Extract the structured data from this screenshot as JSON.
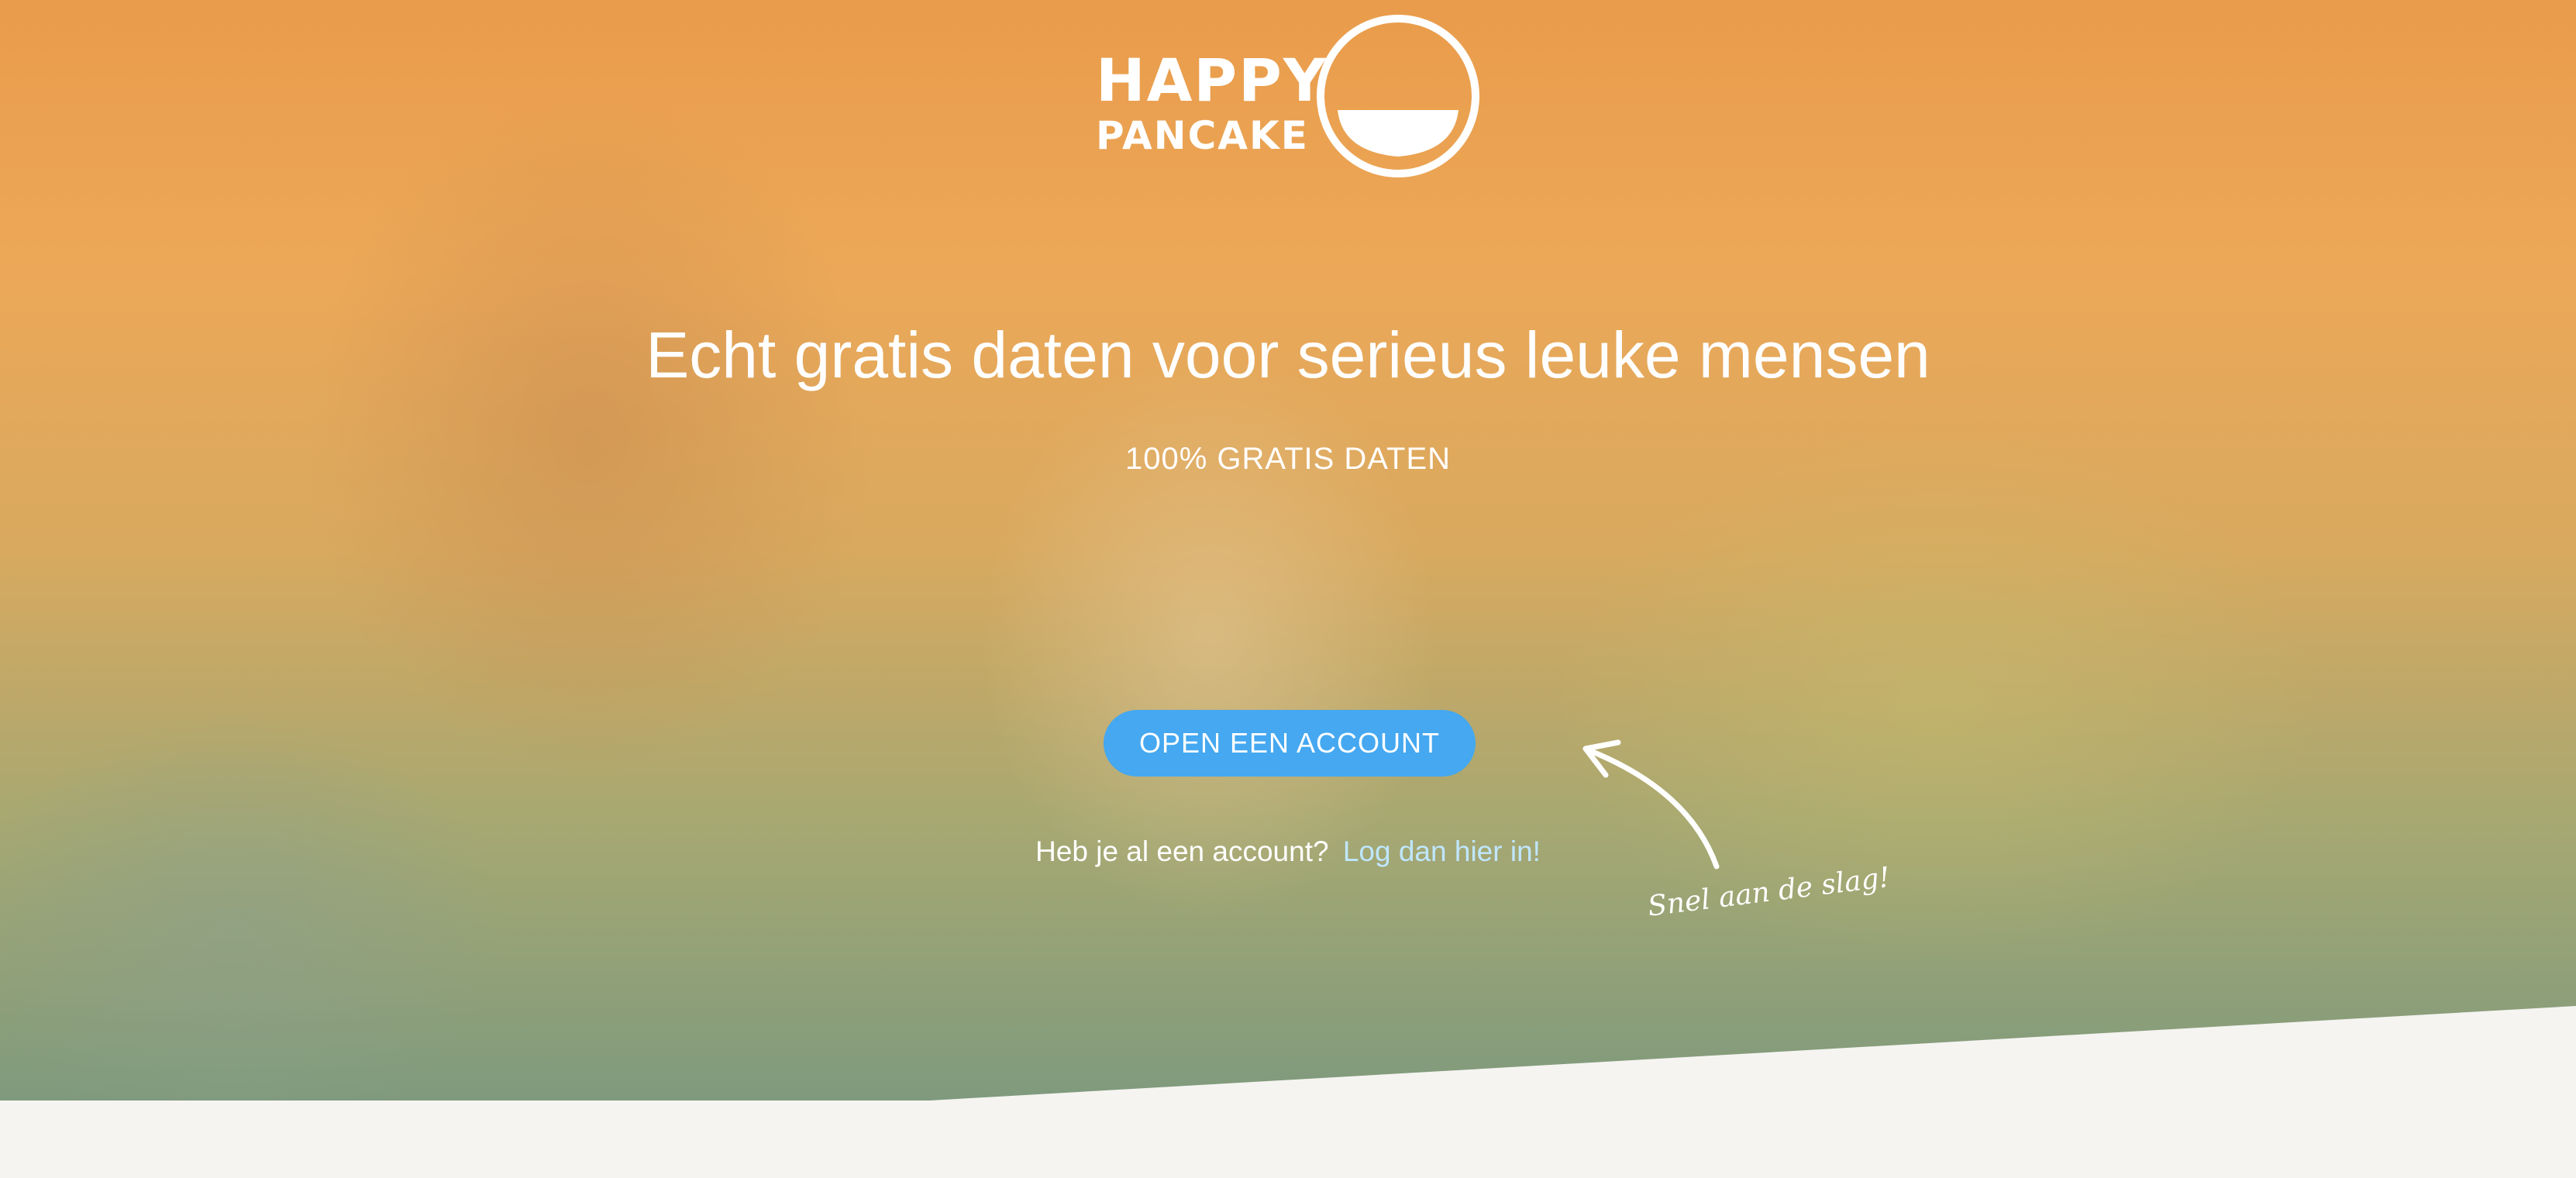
{
  "logo": {
    "line1": "HAPPY",
    "line2": "PANCAKE",
    "face_icon": "smiling-pancake-face-icon"
  },
  "hero": {
    "headline": "Echt gratis daten voor serieus leuke mensen",
    "subheadline": "100% GRATIS DATEN",
    "cta_label": "OPEN EEN ACCOUNT",
    "login_prompt": "Heb je al een account?",
    "login_link": "Log dan hier in!",
    "hint_text": "Snel aan de slag!",
    "hint_icon": "curved-arrow-icon"
  },
  "colors": {
    "cta_background": "#45a8f0",
    "login_link": "#bfe6ff",
    "page_background": "#f5f4f1",
    "hero_top": "#e99c4b",
    "hero_bottom": "#7f9a7d"
  }
}
